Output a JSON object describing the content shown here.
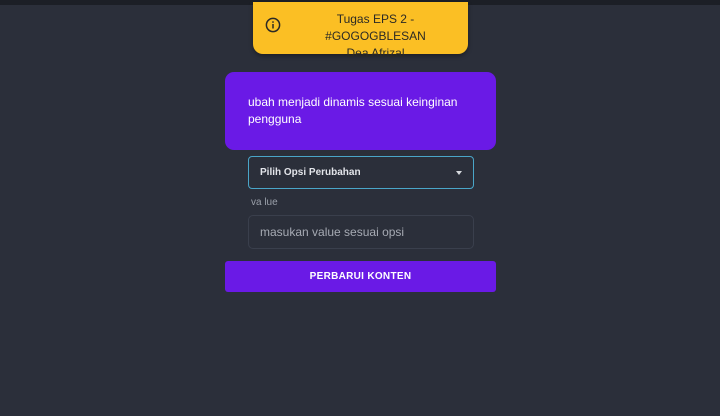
{
  "toast": {
    "icon": "info-icon",
    "line1": "Tugas EPS 2 - #GOGOGBLESAN",
    "line2": "Dea Afrizal",
    "color": "#fbbf24"
  },
  "card": {
    "text": "ubah menjadi dinamis sesuai keinginan pengguna",
    "color": "#6a1ae6"
  },
  "form": {
    "select_selected": "Pilih Opsi Perubahan",
    "select_icon": "chevron-down-icon",
    "value_label": "va lue",
    "value_placeholder": "masukan value sesuai opsi",
    "submit_label": "PERBARUI KONTEN"
  }
}
